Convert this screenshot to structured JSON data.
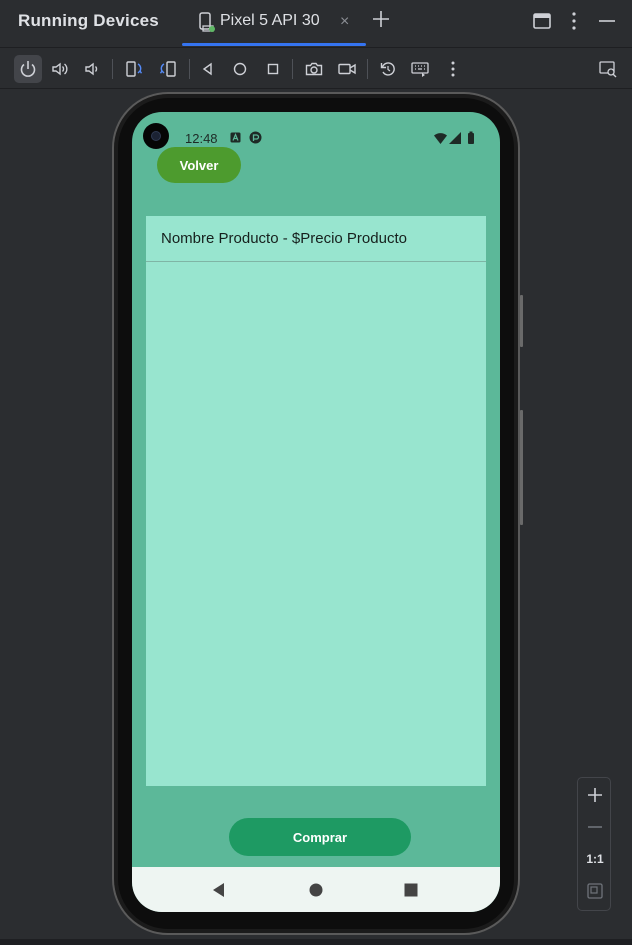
{
  "titlebar": {
    "app_title": "Running Devices",
    "tab_label": "Pixel 5 API 30",
    "tab_close": "×",
    "icons": [
      "device-tab-icon",
      "plus-icon",
      "window-layout-icon",
      "more-vert-icon",
      "minimize-icon"
    ]
  },
  "toolbar": {
    "icons": [
      "power-icon",
      "volume-up-icon",
      "volume-down-icon",
      "rotate-left-icon",
      "rotate-right-icon",
      "back-triangle-icon",
      "home-circle-icon",
      "overview-square-icon",
      "camera-icon",
      "video-icon",
      "reset-icon",
      "keyboard-icon",
      "more-vert-icon",
      "device-explorer-icon"
    ]
  },
  "device": {
    "status": {
      "time": "12:48"
    },
    "app": {
      "back_label": "Volver",
      "items": [
        {
          "text": "Nombre Producto - $Precio Producto"
        }
      ],
      "buy_label": "Comprar",
      "colors": {
        "background": "#5cb899",
        "list": "#98e5cf",
        "back_button": "#4d9b2e",
        "buy_button": "#1e9a63"
      }
    }
  },
  "zoom": {
    "one_to_one": "1:1"
  },
  "theme": {
    "accent": "#3574f0",
    "ide_bg": "#2b2d30"
  }
}
